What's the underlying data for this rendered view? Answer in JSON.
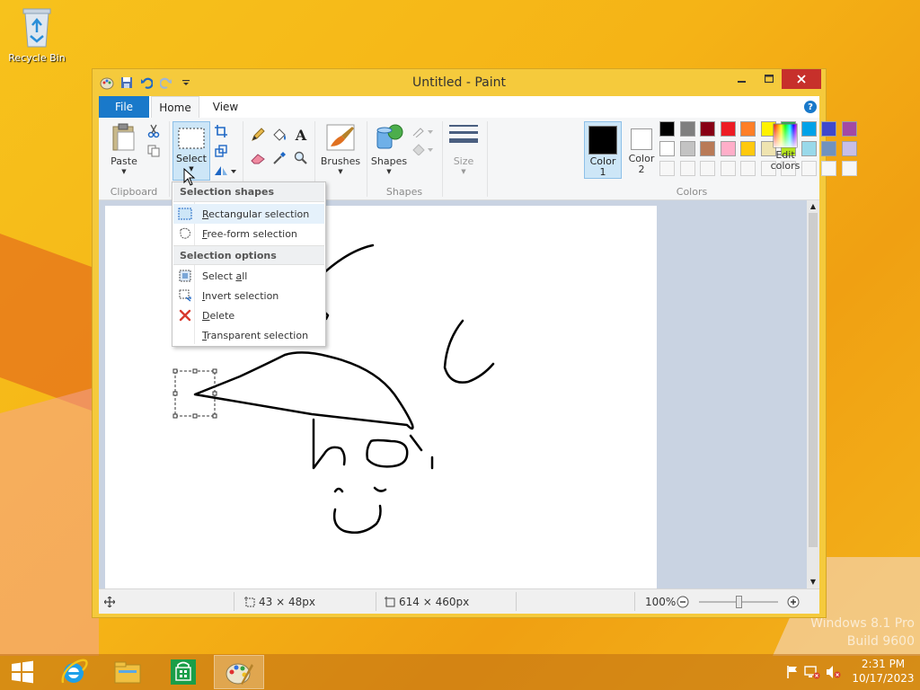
{
  "desktop": {
    "recycle_bin_label": "Recycle Bin",
    "watermark_line1": "Windows 8.1 Pro",
    "watermark_line2": "Build 9600"
  },
  "window": {
    "title": "Untitled - Paint",
    "controls": {
      "minimize": "—",
      "maximize": "☐",
      "close": "✕"
    }
  },
  "ribbon_tabs": {
    "file": "File",
    "home": "Home",
    "view": "View",
    "help": "?"
  },
  "ribbon": {
    "clipboard": {
      "label": "Clipboard",
      "paste": "Paste"
    },
    "image": {
      "select": "Select"
    },
    "tools": {},
    "brushes": "Brushes",
    "shapes": {
      "label": "Shapes",
      "shapes_btn": "Shapes"
    },
    "size": "Size",
    "colors": {
      "label": "Colors",
      "color1": "Color 1",
      "color2": "Color 2",
      "color1_top": "Color",
      "color1_bot": "1",
      "color2_top": "Color",
      "color2_bot": "2",
      "edit_top": "Edit",
      "edit_bot": "colors",
      "palette_row1": [
        "#000000",
        "#7f7f7f",
        "#880015",
        "#ed1c24",
        "#ff7f27",
        "#fff200",
        "#22b14c",
        "#00a2e8",
        "#3f48cc",
        "#a349a4"
      ],
      "palette_row2": [
        "#ffffff",
        "#c3c3c3",
        "#b97a57",
        "#ffaec9",
        "#ffc90e",
        "#efe4b0",
        "#b5e61d",
        "#99d9ea",
        "#7092be",
        "#c8bfe7"
      ],
      "selected_color1": "#000000",
      "selected_color2": "#ffffff"
    }
  },
  "select_menu": {
    "section1": "Selection shapes",
    "rect_prefix": "R",
    "rect_rest": "ectangular selection",
    "free_prefix": "F",
    "free_rest": "ree-form selection",
    "section2": "Selection options",
    "selall_pre": "Select ",
    "selall_u": "a",
    "selall_post": "ll",
    "invert_pre": "",
    "invert_u": "I",
    "invert_post": "nvert selection",
    "delete_pre": "",
    "delete_u": "D",
    "delete_post": "elete",
    "transp_pre": "",
    "transp_u": "T",
    "transp_post": "ransparent selection"
  },
  "statusbar": {
    "selection_size": "43 × 48px",
    "image_size": "614 × 460px",
    "zoom": "100%",
    "zoom_fraction": 0.5
  },
  "taskbar": {
    "time": "2:31 PM",
    "date": "10/17/2023"
  }
}
